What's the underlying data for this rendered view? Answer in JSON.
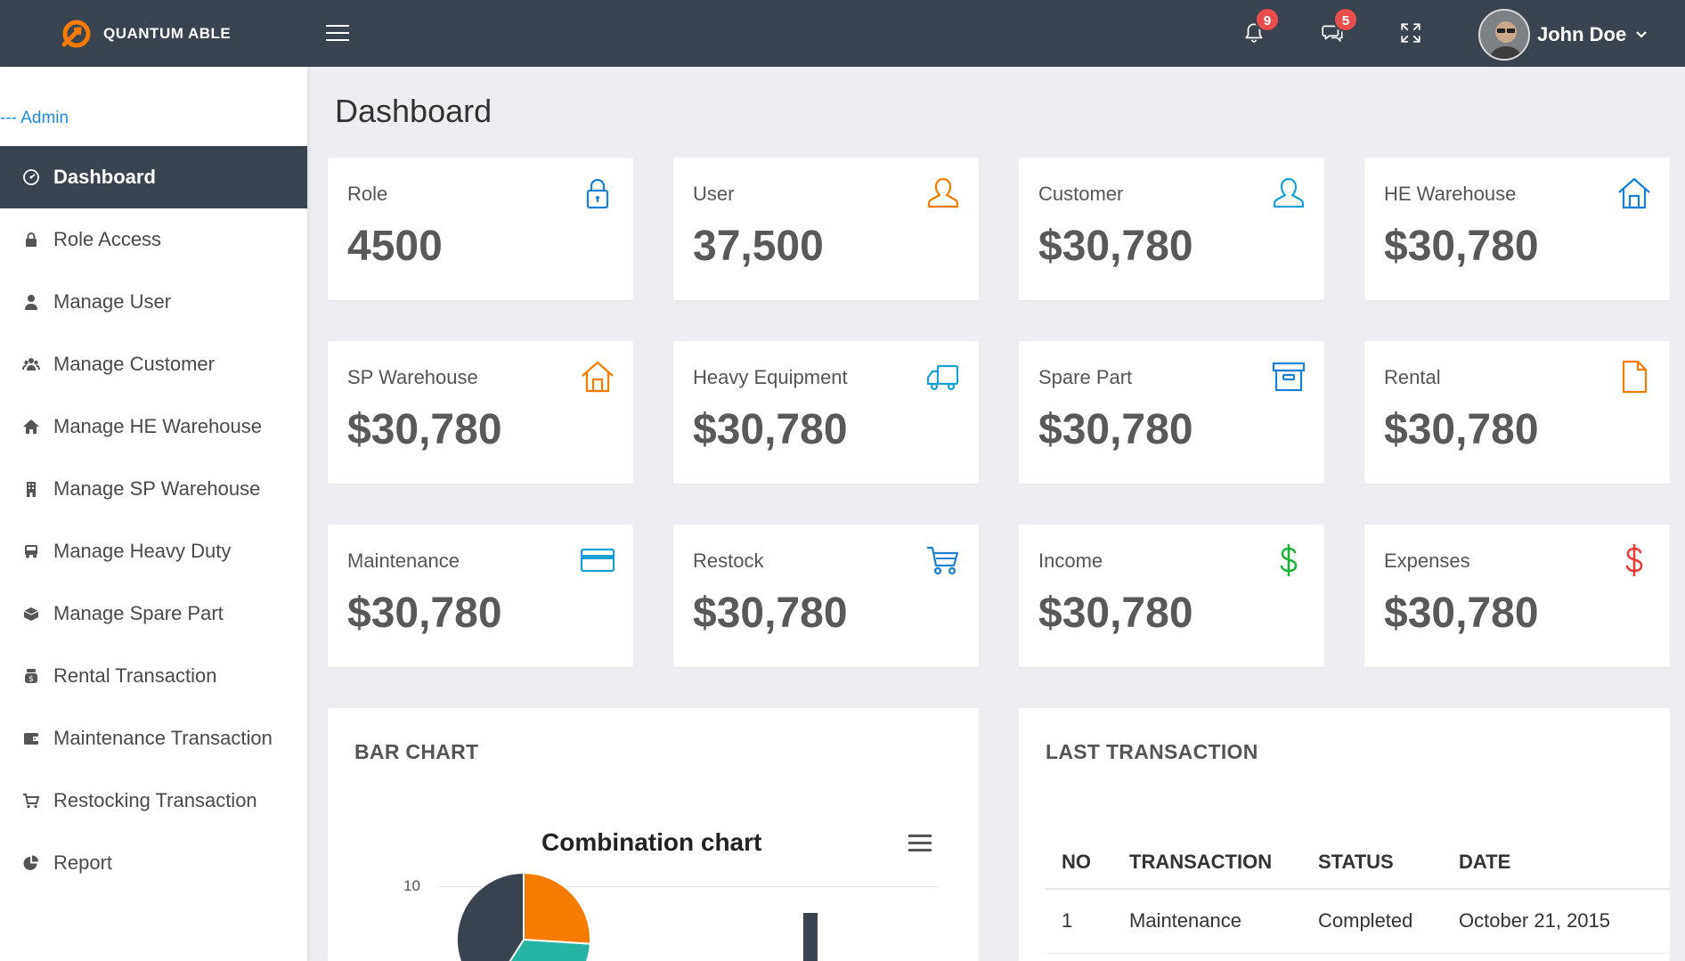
{
  "brand": {
    "name": "QUANTUM ABLE"
  },
  "topbar": {
    "notifications_badge": "9",
    "messages_badge": "5",
    "user_name": "John Doe"
  },
  "sidebar": {
    "section": "--- Admin",
    "items": [
      {
        "label": "Dashboard",
        "icon": "gauge-icon"
      },
      {
        "label": "Role Access",
        "icon": "lock-icon"
      },
      {
        "label": "Manage User",
        "icon": "user-icon"
      },
      {
        "label": "Manage Customer",
        "icon": "users-icon"
      },
      {
        "label": "Manage HE Warehouse",
        "icon": "home-icon"
      },
      {
        "label": "Manage SP Warehouse",
        "icon": "building-icon"
      },
      {
        "label": "Manage Heavy Duty",
        "icon": "truck-icon"
      },
      {
        "label": "Manage Spare Part",
        "icon": "box-icon"
      },
      {
        "label": "Rental Transaction",
        "icon": "money-bag-icon"
      },
      {
        "label": "Maintenance Transaction",
        "icon": "wallet-icon"
      },
      {
        "label": "Restocking Transaction",
        "icon": "cart-icon"
      },
      {
        "label": "Report",
        "icon": "pie-icon"
      }
    ]
  },
  "page": {
    "title": "Dashboard"
  },
  "cards": [
    {
      "label": "Role",
      "value": "4500",
      "icon": "lock-icon",
      "color": "#1a7fd6"
    },
    {
      "label": "User",
      "value": "37,500",
      "icon": "user-outline-icon",
      "color": "#f57c00"
    },
    {
      "label": "Customer",
      "value": "$30,780",
      "icon": "user-outline-icon",
      "color": "#1a9ed6"
    },
    {
      "label": "HE Warehouse",
      "value": "$30,780",
      "icon": "home-outline-icon",
      "color": "#1a7fd6"
    },
    {
      "label": "SP Warehouse",
      "value": "$30,780",
      "icon": "home-outline-icon",
      "color": "#f57c00"
    },
    {
      "label": "Heavy Equipment",
      "value": "$30,780",
      "icon": "truck-outline-icon",
      "color": "#1a9ed6"
    },
    {
      "label": "Spare Part",
      "value": "$30,780",
      "icon": "archive-icon",
      "color": "#1a7fd6"
    },
    {
      "label": "Rental",
      "value": "$30,780",
      "icon": "file-icon",
      "color": "#f57c00"
    },
    {
      "label": "Maintenance",
      "value": "$30,780",
      "icon": "credit-card-icon",
      "color": "#1a9ed6"
    },
    {
      "label": "Restock",
      "value": "$30,780",
      "icon": "cart-outline-icon",
      "color": "#1a7fd6"
    },
    {
      "label": "Income",
      "value": "$30,780",
      "icon": "dollar-icon",
      "color": "#1bb33a"
    },
    {
      "label": "Expenses",
      "value": "$30,780",
      "icon": "dollar-icon",
      "color": "#e53935"
    }
  ],
  "bar_panel": {
    "title": "BAR CHART",
    "chart_title": "Combination chart",
    "y_tick_top": "10"
  },
  "chart_data": {
    "type": "bar",
    "title": "Combination chart",
    "ylim": [
      0,
      10
    ],
    "pie_slices": [
      {
        "name": "",
        "value": 0.26,
        "color": "#f57c00"
      },
      {
        "name": "",
        "value": 0.33,
        "color": "#26b3a2"
      },
      {
        "name": "",
        "value": 0.41,
        "color": "#3a4450"
      }
    ]
  },
  "transactions": {
    "title": "LAST TRANSACTION",
    "columns": [
      "NO",
      "TRANSACTION",
      "STATUS",
      "DATE"
    ],
    "rows": [
      {
        "no": "1",
        "transaction": "Maintenance",
        "status": "Completed",
        "date": "October 21, 2015"
      }
    ]
  }
}
